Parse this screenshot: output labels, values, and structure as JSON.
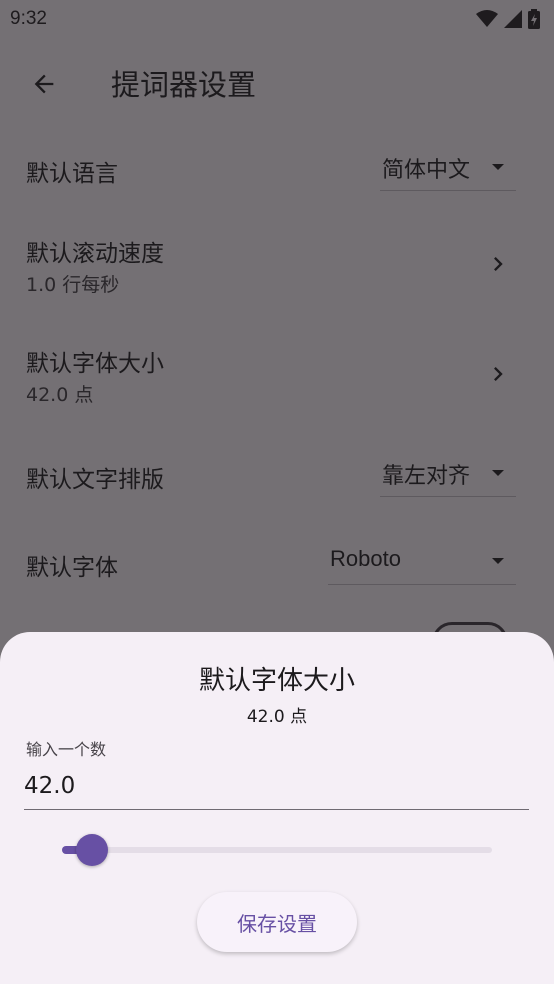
{
  "status_bar": {
    "time": "9:32"
  },
  "app_bar": {
    "title": "提词器设置"
  },
  "settings": {
    "language": {
      "label": "默认语言",
      "value": "简体中文"
    },
    "scroll_speed": {
      "label": "默认滚动速度",
      "value": "1.0 行每秒"
    },
    "font_size": {
      "label": "默认字体大小",
      "value": "42.0 点"
    },
    "text_align": {
      "label": "默认文字排版",
      "value": "靠左对齐"
    },
    "font_family": {
      "label": "默认字体",
      "value": "Roboto"
    }
  },
  "sheet": {
    "title": "默认字体大小",
    "subtitle": "42.0 点",
    "input_label": "输入一个数",
    "input_value": "42.0",
    "slider_value_fraction": 0.07,
    "save_label": "保存设置"
  },
  "colors": {
    "accent": "#6750a4",
    "scrim": "#747074",
    "sheet": "#f5eff6"
  },
  "icons": [
    "wifi-icon",
    "signal-icon",
    "battery-icon",
    "back-arrow-icon",
    "chevron-right-icon",
    "dropdown-arrow-icon"
  ]
}
